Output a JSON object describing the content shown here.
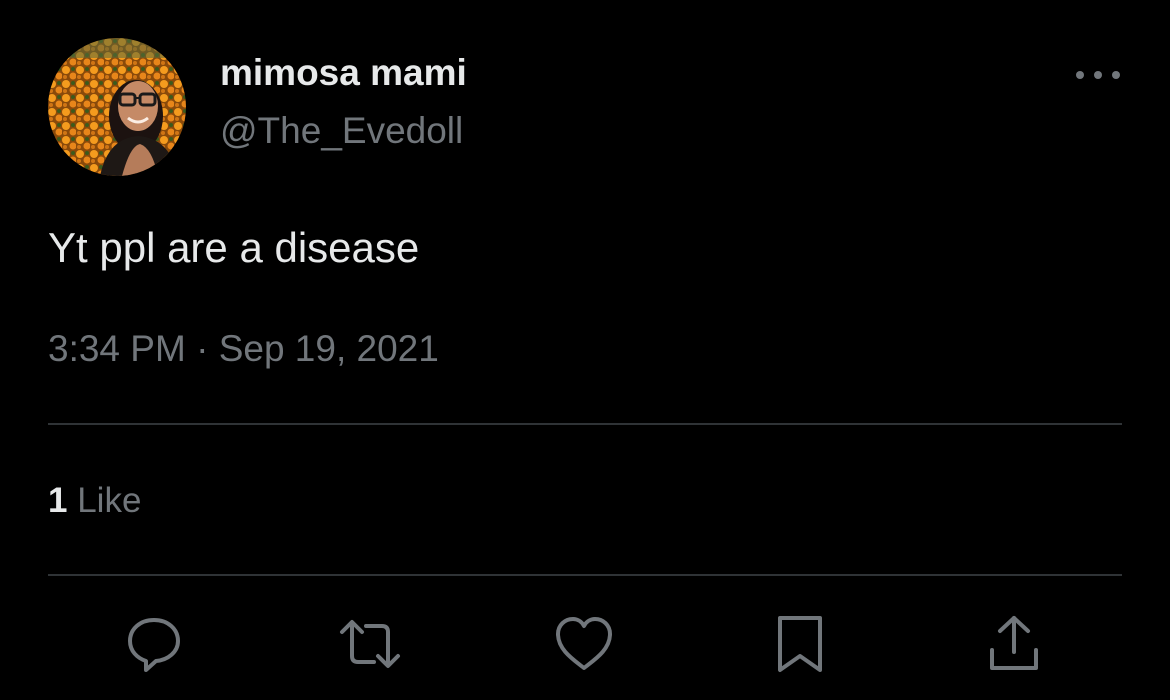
{
  "tweet": {
    "display_name": "mimosa mami",
    "handle": "@The_Evedoll",
    "text": "Yt ppl are a disease",
    "time": "3:34 PM",
    "separator": "·",
    "date": "Sep 19, 2021",
    "likes_count": "1",
    "likes_label": "Like"
  },
  "icons": {
    "more": "more-dots-icon",
    "reply": "reply-icon",
    "retweet": "retweet-icon",
    "like": "heart-icon",
    "bookmark": "bookmark-icon",
    "share": "share-icon"
  },
  "colors": {
    "background": "#000000",
    "primary_text": "#e7e9ea",
    "secondary_text": "#71767b",
    "divider": "#2f3336"
  }
}
